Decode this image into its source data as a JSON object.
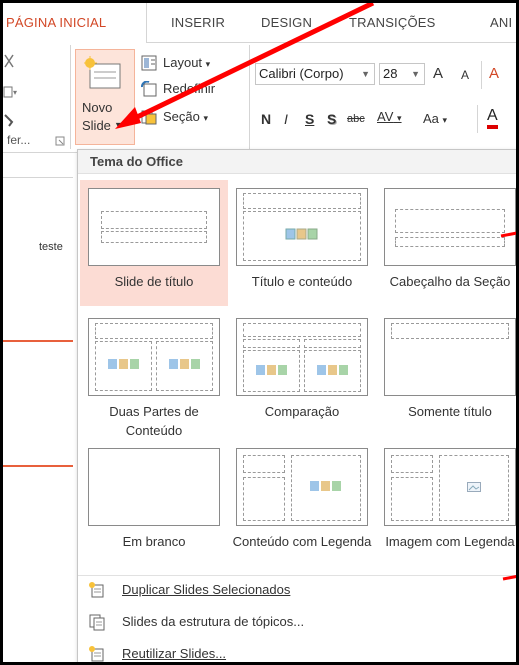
{
  "tabs": [
    {
      "label": "PÁGINA INICIAL",
      "active": true
    },
    {
      "label": "INSERIR",
      "active": false
    },
    {
      "label": "DESIGN",
      "active": false
    },
    {
      "label": "TRANSIÇÕES",
      "active": false
    },
    {
      "label": "ANI",
      "active": false
    }
  ],
  "ribbon": {
    "novo_slide_line1": "Novo",
    "novo_slide_line2": "Slide",
    "layout_label": "Layout",
    "redefinir_label": "Redefinir",
    "secao_label": "Seção",
    "font_name": "Calibri (Corpo)",
    "font_size": "28",
    "grow_font": "A",
    "shrink_font": "A",
    "bold": "N",
    "italic": "I",
    "underline": "S",
    "strike": "S",
    "abc": "abc",
    "spacing": "AV",
    "case": "Aa",
    "clipboard_group_label": "fer...",
    "accent_color": "#d24726"
  },
  "left_panel": {
    "slide_text": "teste"
  },
  "dropdown": {
    "header": "Tema do Office",
    "layouts": [
      {
        "label": "Slide de título",
        "selected": true
      },
      {
        "label": "Título e conteúdo",
        "selected": false
      },
      {
        "label": "Cabeçalho da Seção",
        "selected": false
      },
      {
        "label": "Duas Partes de Conteúdo",
        "selected": false
      },
      {
        "label": "Comparação",
        "selected": false
      },
      {
        "label": "Somente título",
        "selected": false
      },
      {
        "label": "Em branco",
        "selected": false
      },
      {
        "label": "Conteúdo com Legenda",
        "selected": false
      },
      {
        "label": "Imagem com Legenda",
        "selected": false
      }
    ],
    "menu": [
      {
        "label": "Duplicar Slides Selecionados",
        "icon": "duplicate-slides-icon"
      },
      {
        "label": "Slides da estrutura de tópicos...",
        "icon": "outline-slides-icon"
      },
      {
        "label": "Reutilizar Slides...",
        "icon": "reuse-slides-icon"
      }
    ]
  },
  "annotation_color": "#ff0000"
}
